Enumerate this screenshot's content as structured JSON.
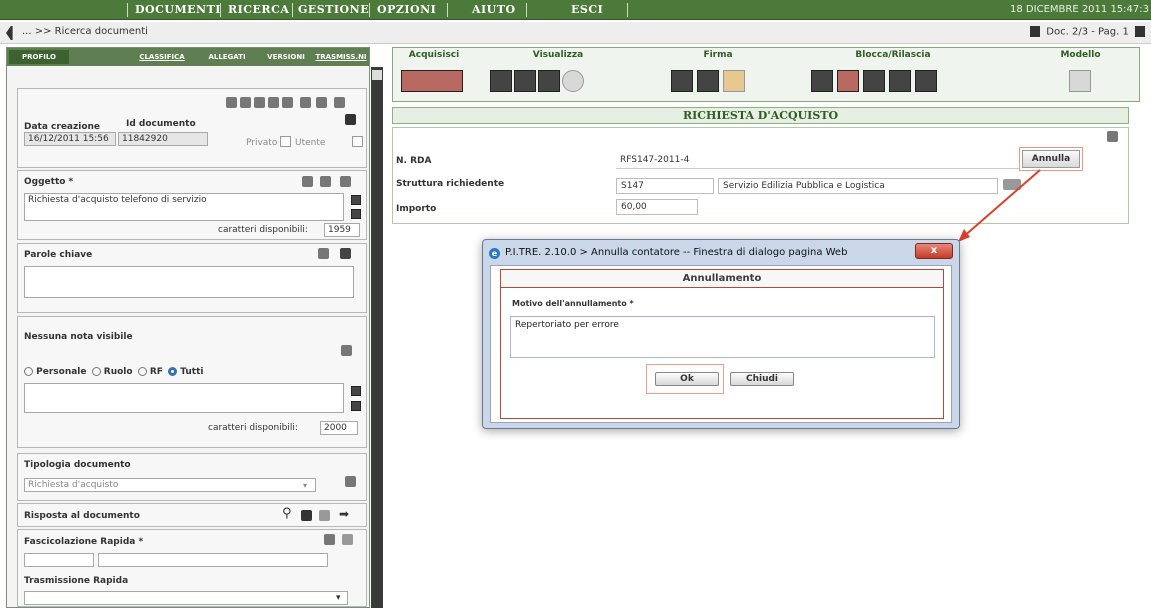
{
  "menu": {
    "items": [
      "DOCUMENTI",
      "RICERCA",
      "GESTIONE",
      "OPZIONI",
      "AIUTO",
      "ESCI"
    ],
    "date": "18 DICEMBRE 2011 15:47:3"
  },
  "breadcrumb": {
    "text": "... >> Ricerca documenti",
    "doc_nav": "Doc. 2/3 - Pag. 1"
  },
  "tabs": [
    "PROFILO",
    "CLASSIFICA",
    "ALLEGATI",
    "VERSIONI",
    "TRASMISS.NI"
  ],
  "profilo": {
    "data_creazione_label": "Data creazione",
    "id_documento_label": "Id documento",
    "data_creazione": "16/12/2011 15:56",
    "id_documento": "11842920",
    "privato_label": "Privato",
    "utente_label": "Utente",
    "oggetto_label": "Oggetto *",
    "oggetto_value": "Richiesta d'acquisto telefono di servizio",
    "caratteri_label": "caratteri disponibili:",
    "caratteri_oggetto": "1959",
    "parole_chiave_label": "Parole chiave",
    "nota_label": "Nessuna nota visibile",
    "radio_personale": "Personale",
    "radio_ruolo": "Ruolo",
    "radio_rf": "RF",
    "radio_tutti": "Tutti",
    "caratteri_note": "2000",
    "tipologia_label": "Tipologia documento",
    "tipologia_value": "Richiesta d'acquisto",
    "risposta_label": "Risposta al documento",
    "fascicolazione_label": "Fascicolazione Rapida *",
    "trasmissione_label": "Trasmissione Rapida"
  },
  "toolbar": {
    "acquisisci": "Acquisisci",
    "visualizza": "Visualizza",
    "firma": "Firma",
    "blocca": "Blocca/Rilascia",
    "modello": "Modello"
  },
  "form": {
    "title": "RICHIESTA D'ACQUISTO",
    "nrda_label": "N. RDA",
    "nrda_value": "RFS147-2011-4",
    "annulla_label": "Annulla",
    "struttura_label": "Struttura richiedente",
    "struttura_code": "S147",
    "struttura_name": "Servizio Edilizia Pubblica e Logistica",
    "importo_label": "Importo",
    "importo_value": "60,00"
  },
  "dialog": {
    "title": "P.I.TRE. 2.10.0 > Annulla contatore -- Finestra di dialogo pagina Web",
    "close": "x",
    "heading": "Annullamento",
    "motivo_label": "Motivo dell'annullamento *",
    "motivo_value": "Repertoriato per errore",
    "ok": "Ok",
    "chiudi": "Chiudi"
  },
  "colors": {
    "menu_green": "#4c7a3b",
    "accent_red": "#b04a3c"
  }
}
